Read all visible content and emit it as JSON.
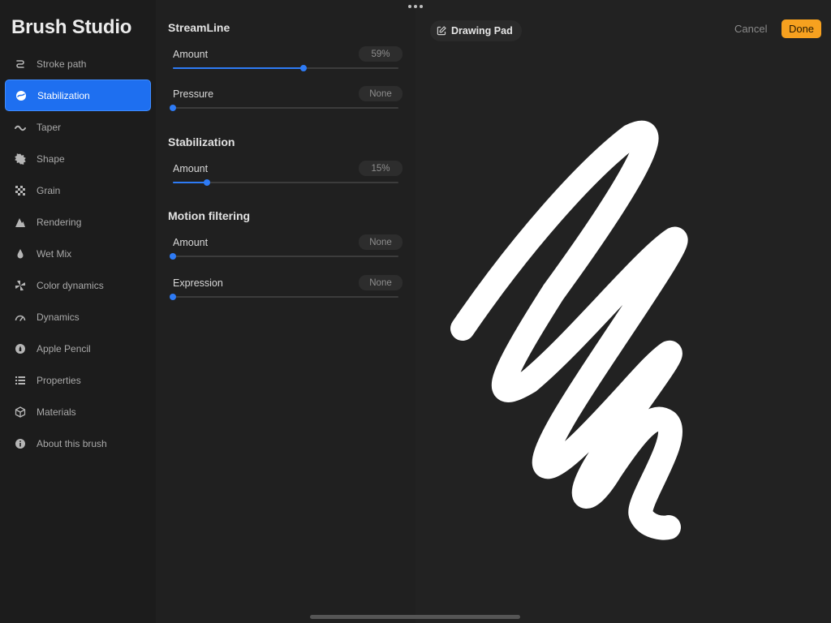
{
  "app": {
    "title": "Brush Studio"
  },
  "sidebar": {
    "items": [
      {
        "label": "Stroke path",
        "icon": "stroke-path-icon",
        "active": false
      },
      {
        "label": "Stabilization",
        "icon": "stabilization-icon",
        "active": true
      },
      {
        "label": "Taper",
        "icon": "taper-icon",
        "active": false
      },
      {
        "label": "Shape",
        "icon": "shape-icon",
        "active": false
      },
      {
        "label": "Grain",
        "icon": "grain-icon",
        "active": false
      },
      {
        "label": "Rendering",
        "icon": "rendering-icon",
        "active": false
      },
      {
        "label": "Wet Mix",
        "icon": "wet-mix-icon",
        "active": false
      },
      {
        "label": "Color dynamics",
        "icon": "color-dynamics-icon",
        "active": false
      },
      {
        "label": "Dynamics",
        "icon": "dynamics-icon",
        "active": false
      },
      {
        "label": "Apple Pencil",
        "icon": "apple-pencil-icon",
        "active": false
      },
      {
        "label": "Properties",
        "icon": "properties-icon",
        "active": false
      },
      {
        "label": "Materials",
        "icon": "materials-icon",
        "active": false
      },
      {
        "label": "About this brush",
        "icon": "info-icon",
        "active": false
      }
    ]
  },
  "panel": {
    "sections": [
      {
        "title": "StreamLine",
        "settings": [
          {
            "label": "Amount",
            "value": "59%",
            "level": 0.58
          },
          {
            "label": "Pressure",
            "value": "None",
            "level": 0
          }
        ]
      },
      {
        "title": "Stabilization",
        "settings": [
          {
            "label": "Amount",
            "value": "15%",
            "level": 0.15
          }
        ]
      },
      {
        "title": "Motion filtering",
        "settings": [
          {
            "label": "Amount",
            "value": "None",
            "level": 0
          },
          {
            "label": "Expression",
            "value": "None",
            "level": 0
          }
        ]
      }
    ]
  },
  "canvas": {
    "drawing_pad_label": "Drawing Pad",
    "cancel_label": "Cancel",
    "done_label": "Done"
  },
  "colors": {
    "accent": "#1e6ff0",
    "slider": "#2e7bf5",
    "done": "#f7a11f",
    "stroke": "#ffffff"
  }
}
